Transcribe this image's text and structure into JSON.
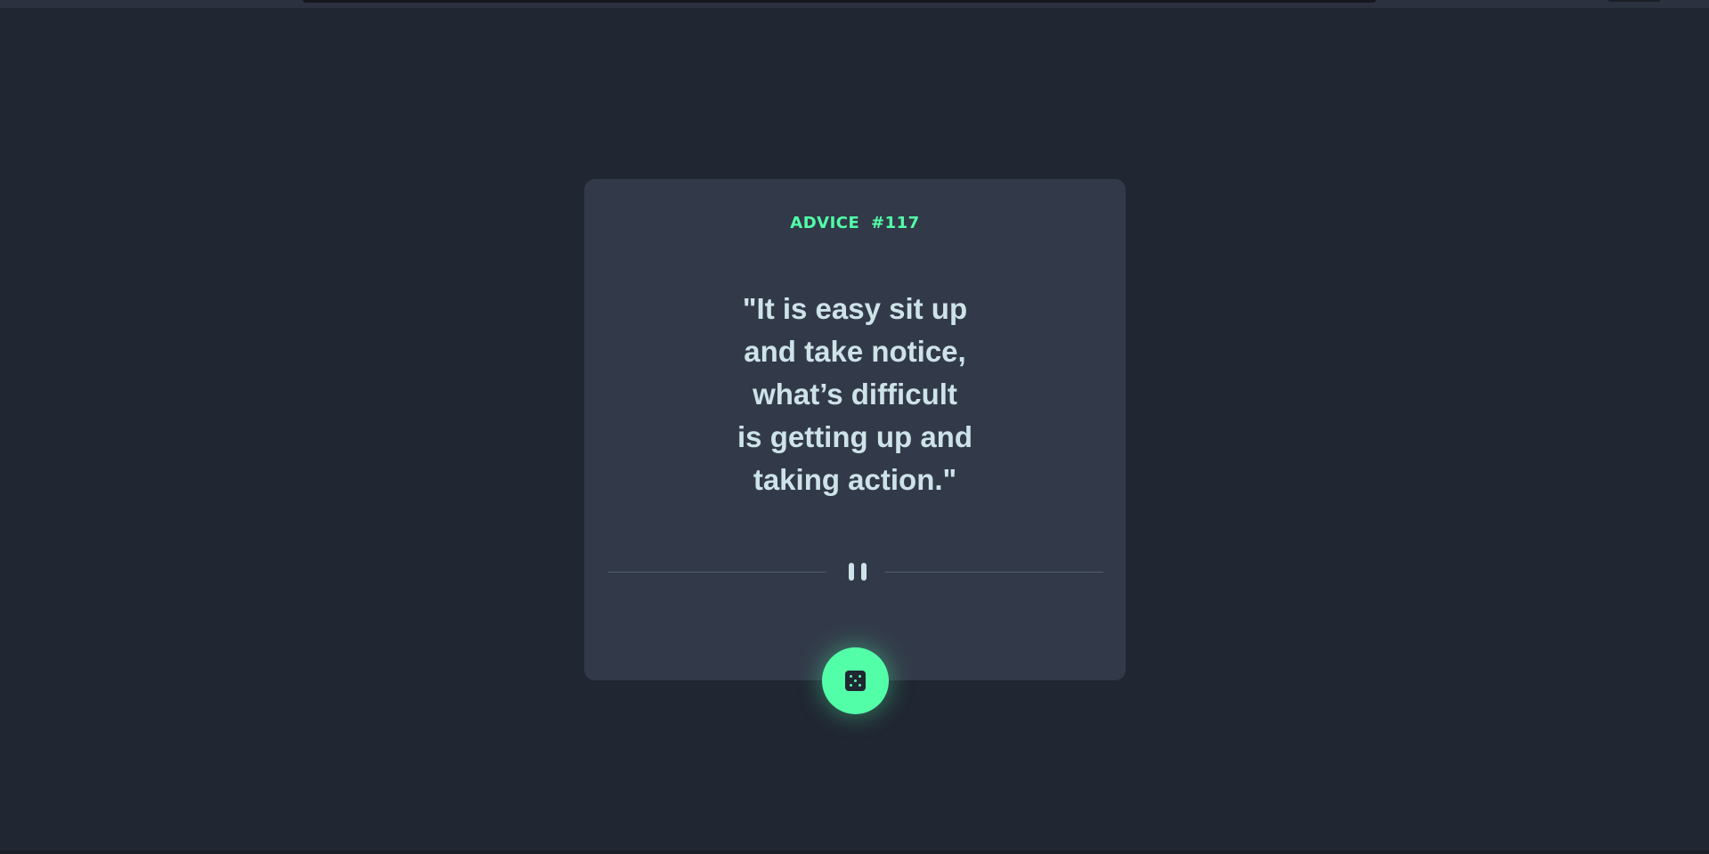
{
  "advice": {
    "label": "ADVICE #117",
    "quote": "\"It is easy sit up\nand take  notice,\nwhat’s difficult\nis getting up and\ntaking action.\""
  },
  "divider": {
    "icon": "pause-icon"
  },
  "button": {
    "icon": "dice-icon"
  },
  "colors": {
    "background": "#202632",
    "card": "#323a49",
    "accent": "#52ffa8",
    "text": "#cee3e9"
  }
}
